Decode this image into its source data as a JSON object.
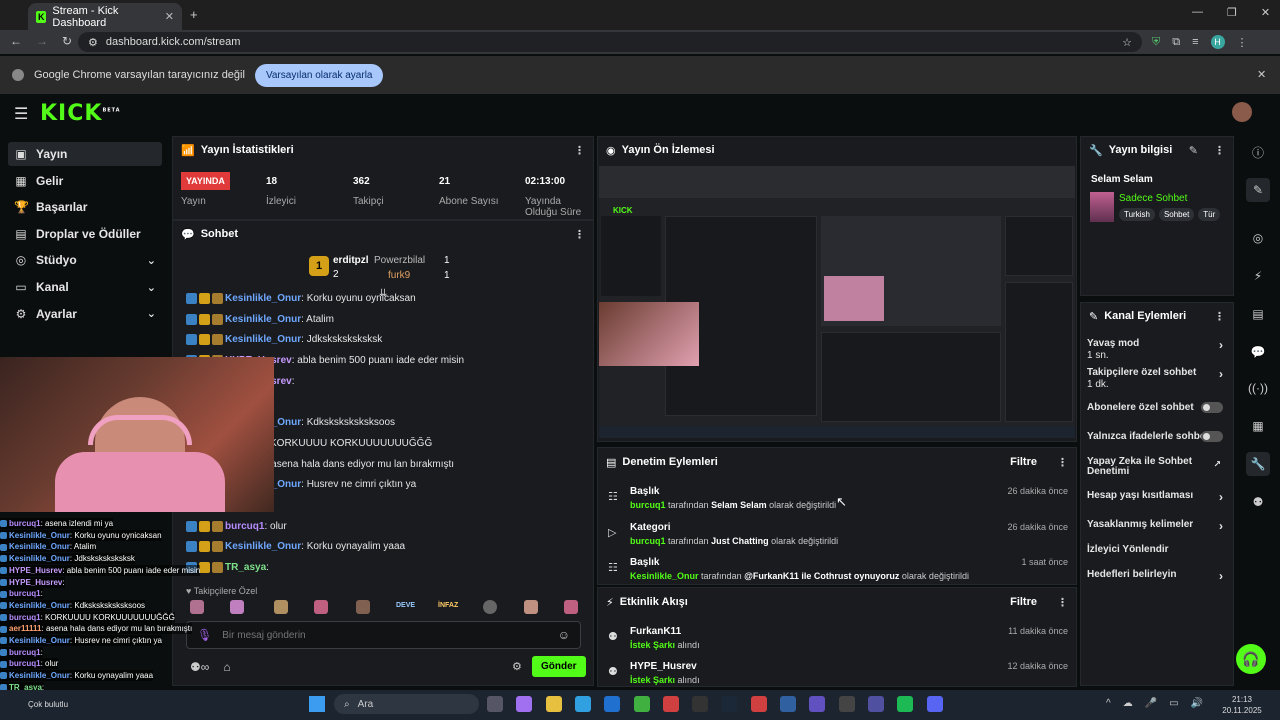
{
  "browser": {
    "tab_title": "Stream - Kick Dashboard",
    "url": "dashboard.kick.com/stream",
    "infobar_text": "Google Chrome varsayılan tarayıcınız değil",
    "infobar_button": "Varsayılan olarak ayarla",
    "profile_initial": "H"
  },
  "app": {
    "logo": "KICK",
    "logo_badge": "BETA"
  },
  "sidebar": {
    "items": [
      {
        "label": "Yayın",
        "icon": "broadcast-icon"
      },
      {
        "label": "Gelir",
        "icon": "wallet-icon"
      },
      {
        "label": "Başarılar",
        "icon": "trophy-icon"
      },
      {
        "label": "Droplar ve Ödüller",
        "icon": "gift-icon"
      },
      {
        "label": "Stüdyo",
        "icon": "studio-icon"
      },
      {
        "label": "Kanal",
        "icon": "channel-icon"
      },
      {
        "label": "Ayarlar",
        "icon": "gear-icon"
      }
    ]
  },
  "stats": {
    "title": "Yayın İstatistikleri",
    "status_badge": "YAYINDA",
    "status_label": "Yayın",
    "items": [
      {
        "value": "18",
        "label": "İzleyici"
      },
      {
        "value": "362",
        "label": "Takipçi"
      },
      {
        "value": "21",
        "label": "Abone Sayısı"
      },
      {
        "value": "02:13:00",
        "label": "Yayında Olduğu Süre"
      }
    ]
  },
  "chat": {
    "title": "Sohbet",
    "leaders": [
      {
        "rank": "1",
        "name": "erditpzl",
        "count": "2"
      },
      {
        "name": "Powerzbilal",
        "count": "1"
      },
      {
        "name": "furk9",
        "count": "1"
      }
    ],
    "messages": [
      {
        "user": "Kesinlikle_Onur",
        "text": ": Korku oyunu oynicaksan"
      },
      {
        "user": "Kesinlikle_Onur",
        "text": ": Atalim"
      },
      {
        "user": "Kesinlikle_Onur",
        "text": ": Jdksksksksksksk"
      },
      {
        "user": "HYPE_Husrev",
        "text": ": abla benim 500 puanı iade eder misin"
      },
      {
        "user": "HYPE_Husrev",
        "text": ":"
      },
      {
        "user": "burcuq1",
        "text": ":"
      },
      {
        "user": "Kesinlikle_Onur",
        "text": ": Kdksksksksksksoos"
      },
      {
        "user": "burcuq1",
        "text": ": KORKUUUU KORKUUUUUUUĞĞĞ"
      },
      {
        "user": "aer11111",
        "text": ": asena hala dans ediyor mu lan bırakmıştı"
      },
      {
        "user": "Kesinlikle_Onur",
        "text": ": Husrev ne cimri çıktın ya"
      },
      {
        "user": "burcuq1",
        "text": ":"
      },
      {
        "user": "burcuq1",
        "text": ": olur"
      },
      {
        "user": "Kesinlikle_Onur",
        "text": ": Korku oynayalim yaaa"
      },
      {
        "user": "TR_asya",
        "text": ":"
      }
    ],
    "followers_only": "Takipçilere Özel",
    "emotes": [
      "DEVE",
      "İNFAZ"
    ],
    "input_placeholder": "Bir mesaj gönderin",
    "send_button": "Gönder"
  },
  "overlay_chat": [
    {
      "user": "burcuq1",
      "text": ": asena izlendi mi ya"
    },
    {
      "user": "Kesinlikle_Onur",
      "text": ": Korku oyunu oynicaksan"
    },
    {
      "user": "Kesinlikle_Onur",
      "text": ": Atalim"
    },
    {
      "user": "Kesinlikle_Onur",
      "text": ": Jdksksksksksksk"
    },
    {
      "user": "HYPE_Husrev",
      "text": ": abla benim 500 puanı iade eder misin"
    },
    {
      "user": "HYPE_Husrev",
      "text": ":"
    },
    {
      "user": "burcuq1",
      "text": ":"
    },
    {
      "user": "Kesinlikle_Onur",
      "text": ": Kdksksksksksksoos"
    },
    {
      "user": "burcuq1",
      "text": ": KORKUUUU KORKUUUUUUUĞĞĞ"
    },
    {
      "user": "aer11111",
      "text": ": asena hala dans ediyor mu lan bırakmıştı"
    },
    {
      "user": "Kesinlikle_Onur",
      "text": ": Husrev ne cimri çıktın ya"
    },
    {
      "user": "burcuq1",
      "text": ":"
    },
    {
      "user": "burcuq1",
      "text": ": olur"
    },
    {
      "user": "Kesinlikle_Onur",
      "text": ": Korku oynayalim yaaa"
    },
    {
      "user": "TR_asya",
      "text": ":"
    }
  ],
  "preview": {
    "title": "Yayın Ön İzlemesi"
  },
  "moderation": {
    "title": "Denetim Eylemleri",
    "filter": "Filtre",
    "items": [
      {
        "title": "Başlık",
        "user": "burcuq1",
        "mid": "tarafından",
        "value": "Selam Selam",
        "end": "olarak değiştirildi",
        "time": "26 dakika önce"
      },
      {
        "title": "Kategori",
        "user": "burcuq1",
        "mid": "tarafından",
        "value": "Just Chatting",
        "end": "olarak değiştirildi",
        "time": "26 dakika önce"
      },
      {
        "title": "Başlık",
        "user": "Kesinlikle_Onur",
        "mid": "tarafından",
        "value": "@FurkanK11 ile Cothrust oynuyoruz",
        "end": "olarak değiştirildi",
        "time": "1 saat önce"
      }
    ]
  },
  "activity": {
    "title": "Etkinlik Akışı",
    "filter": "Filtre",
    "items": [
      {
        "user": "FurkanK11",
        "action": "İstek Şarkı",
        "end": "alındı",
        "time": "11 dakika önce"
      },
      {
        "user": "HYPE_Husrev",
        "action": "İstek Şarkı",
        "end": "alındı",
        "time": "12 dakika önce"
      }
    ]
  },
  "stream_info": {
    "title": "Yayın bilgisi",
    "stream_title": "Selam Selam",
    "category": "Sadece Sohbet",
    "tags": [
      "Turkish",
      "Sohbet",
      "Tür"
    ]
  },
  "channel_actions": {
    "title": "Kanal Eylemleri",
    "items": [
      {
        "label": "Yavaş mod",
        "sub": "1 sn.",
        "control": "chevron"
      },
      {
        "label": "Takipçilere özel sohbet",
        "sub": "1 dk.",
        "control": "chevron"
      },
      {
        "label": "Abonelere özel sohbet",
        "sub": "",
        "control": "toggle"
      },
      {
        "label": "Yalnızca ifadelerle sohbet",
        "sub": "",
        "control": "toggle"
      },
      {
        "label": "Yapay Zeka ile Sohbet Denetimi",
        "sub": "",
        "control": "external"
      },
      {
        "label": "Hesap yaşı kısıtlaması",
        "sub": "",
        "control": "chevron"
      },
      {
        "label": "Yasaklanmış kelimeler",
        "sub": "",
        "control": "chevron"
      },
      {
        "label": "İzleyici Yönlendir",
        "sub": "",
        "control": "none"
      },
      {
        "label": "Hedefleri belirleyin",
        "sub": "",
        "control": "chevron"
      }
    ]
  },
  "taskbar": {
    "search_placeholder": "Ara",
    "time": "21:13",
    "date": "20.11.2025",
    "weather": "Çok bulutlu"
  },
  "colors": {
    "accent": "#53fc18",
    "live": "#e03a3a",
    "panel": "#191b1f"
  }
}
